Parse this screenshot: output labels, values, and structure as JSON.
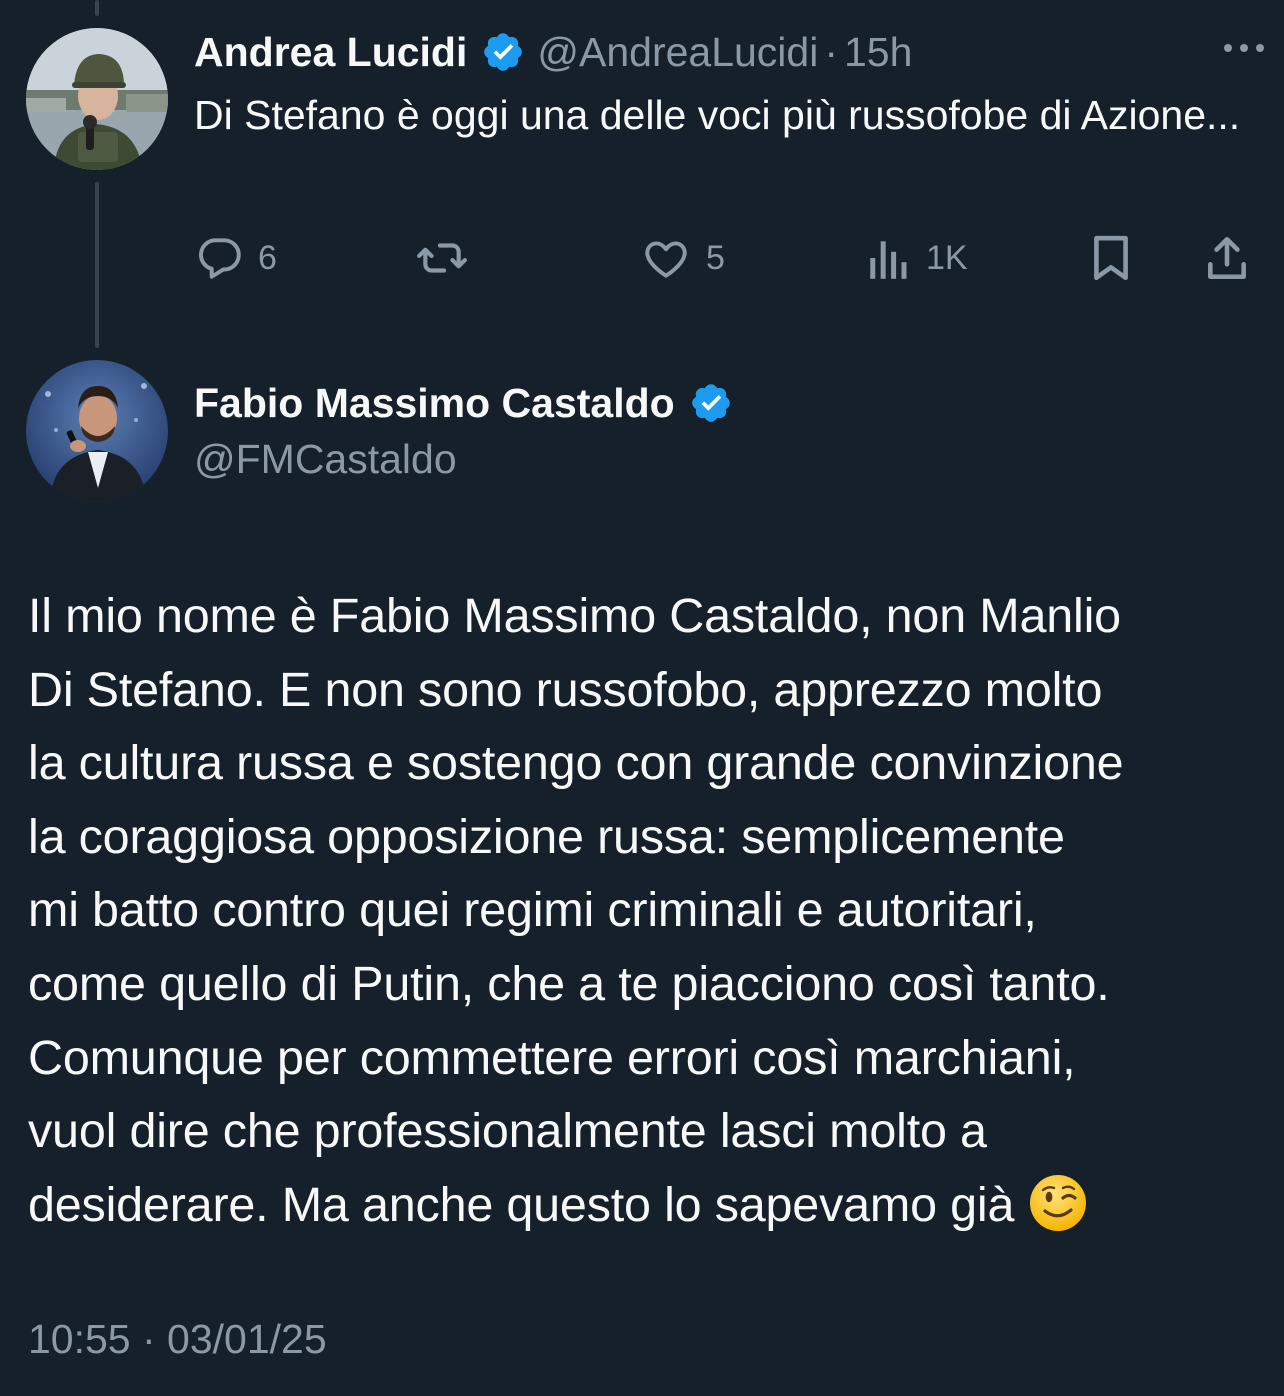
{
  "parent_tweet": {
    "author_name": "Andrea Lucidi",
    "author_handle": "@AndreaLucidi",
    "separator": "·",
    "time_ago": "15h",
    "text": "Di Stefano è oggi una delle voci più russofobe di Azione...",
    "actions": {
      "reply_count": "6",
      "retweet_count": "",
      "like_count": "5",
      "view_count": "1K"
    },
    "icons": [
      "verified-badge-icon",
      "more-icon",
      "reply-icon",
      "retweet-icon",
      "like-icon",
      "views-icon",
      "bookmark-icon",
      "share-icon"
    ]
  },
  "main_tweet": {
    "author_name": "Fabio Massimo Castaldo",
    "author_handle": "@FMCastaldo",
    "text_lines": [
      "Il mio nome è Fabio Massimo Castaldo, non Manlio",
      "Di Stefano. E non sono russofobo, apprezzo molto",
      "la cultura russa e sostengo con grande convinzione",
      "la coraggiosa opposizione russa: semplicemente",
      "mi batto contro quei regimi criminali e autoritari,",
      "come quello di Putin, che a te piacciono così tanto.",
      "Comunque per commettere errori così marchiani,",
      "vuol dire che professionalmente lasci molto a",
      "desiderare. Ma anche questo lo sapevamo già"
    ],
    "emoji": "winking-face-emoji",
    "timestamp": "10:55 · 03/01/25"
  },
  "colors": {
    "background": "#15202b",
    "text_primary": "#f7f9f9",
    "text_secondary": "#8b98a5",
    "verified_blue": "#1d9bf0",
    "thread_line": "#38444d"
  }
}
